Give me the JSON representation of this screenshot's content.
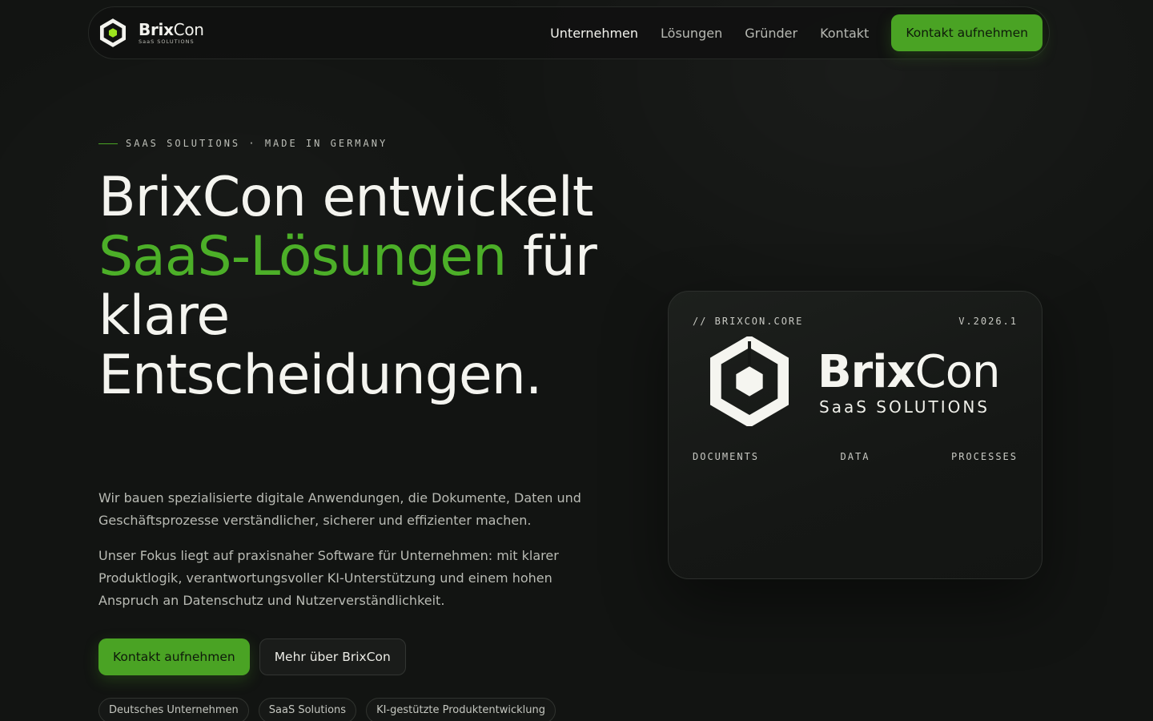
{
  "nav": {
    "brand_name_bold": "Brix",
    "brand_name_light": "Con",
    "brand_sub": "SaaS SOLUTIONS",
    "links": [
      {
        "label": "Unternehmen",
        "active": true
      },
      {
        "label": "Lösungen",
        "active": false
      },
      {
        "label": "Gründer",
        "active": false
      },
      {
        "label": "Kontakt",
        "active": false
      }
    ],
    "cta_label": "Kontakt aufnehmen"
  },
  "hero": {
    "eyebrow": "SAAS SOLUTIONS · MADE IN GERMANY",
    "headline_part1": "BrixCon entwickelt ",
    "headline_accent": "SaaS-Lösungen",
    "headline_part2": " für klare Entscheidungen.",
    "paragraph1": "Wir bauen spezialisierte digitale Anwendungen, die Dokumente, Daten und Geschäftsprozesse verständlicher, sicherer und effizienter machen.",
    "paragraph2": "Unser Fokus liegt auf praxisnaher Software für Unternehmen: mit klarer Produktlogik, verantwortungsvoller KI-Unterstützung und einem hohen Anspruch an Datenschutz und Nutzerverständlichkeit.",
    "primary_button": "Kontakt aufnehmen",
    "secondary_button": "Mehr über BrixCon",
    "chips": [
      "Deutsches Unternehmen",
      "SaaS Solutions",
      "KI-gestützte Produktentwicklung"
    ]
  },
  "card": {
    "label_left": "// BRIXCON.CORE",
    "label_right": "V.2026.1",
    "logo_name_bold": "Brix",
    "logo_name_light": "Con",
    "logo_sub": "SaaS SOLUTIONS",
    "tags": [
      "DOCUMENTS",
      "DATA",
      "PROCESSES"
    ]
  },
  "colors": {
    "background": "#121412",
    "accent_green": "#4caf28",
    "button_green": "#4aa324",
    "text_primary": "#f4f4ef",
    "text_muted": "#b9bbb4"
  },
  "icons": {
    "brand_logo": "hexagon-cube-logo-icon"
  }
}
